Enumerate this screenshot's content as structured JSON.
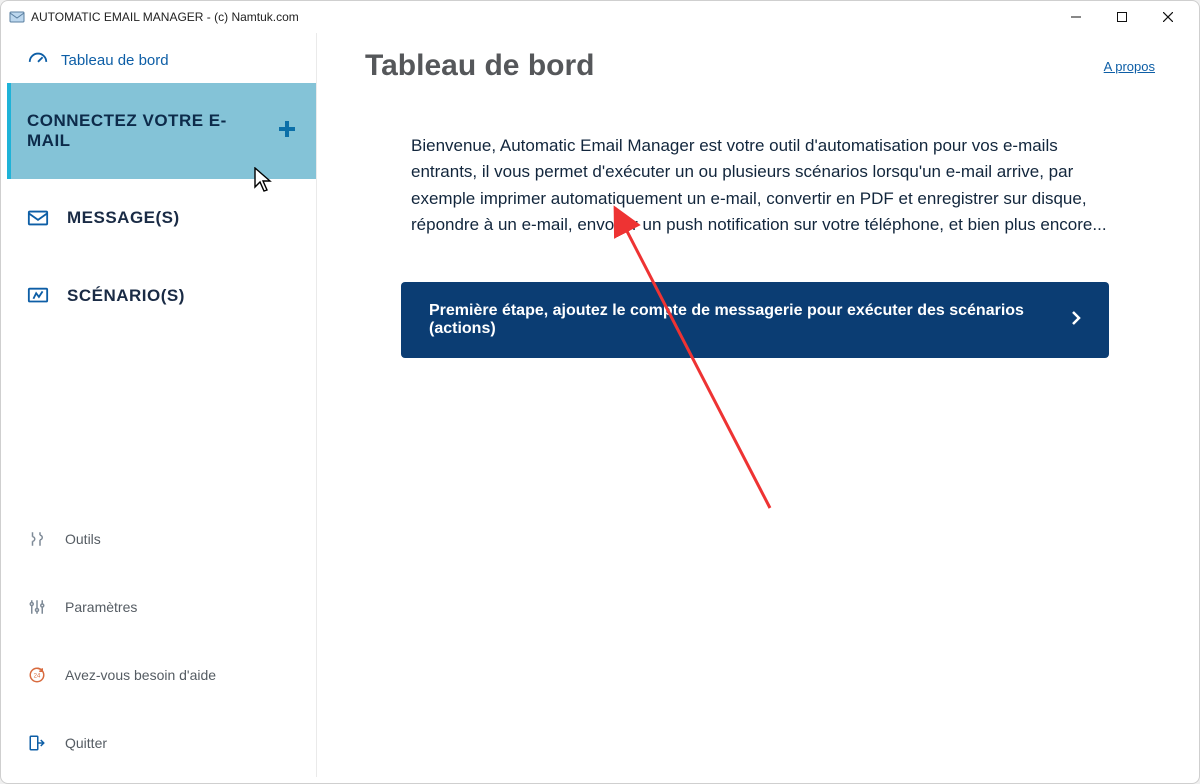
{
  "window": {
    "title": "AUTOMATIC EMAIL MANAGER - (c) Namtuk.com"
  },
  "sidebar": {
    "dashboard_label": "Tableau de bord",
    "items": [
      {
        "label": "CONNECTEZ VOTRE E-MAIL"
      },
      {
        "label": "MESSAGE(S)"
      },
      {
        "label": "SCÉNARIO(S)"
      }
    ],
    "bottom": [
      {
        "label": "Outils"
      },
      {
        "label": "Paramètres"
      },
      {
        "label": "Avez-vous besoin d'aide"
      },
      {
        "label": "Quitter"
      }
    ]
  },
  "main": {
    "title": "Tableau de bord",
    "about_label": "A propos",
    "welcome_text": "Bienvenue, Automatic Email Manager est votre outil d'automatisation pour vos e-mails entrants, il vous permet d'exécuter un ou plusieurs scénarios lorsqu'un e-mail arrive, par exemple imprimer automatiquement un e-mail, convertir en PDF et enregistrer sur disque, répondre à un e-mail, envoyer un push notification sur votre téléphone, et bien plus encore...",
    "cta_label": "Première étape, ajoutez le compte de messagerie pour exécuter des scénarios (actions)"
  }
}
